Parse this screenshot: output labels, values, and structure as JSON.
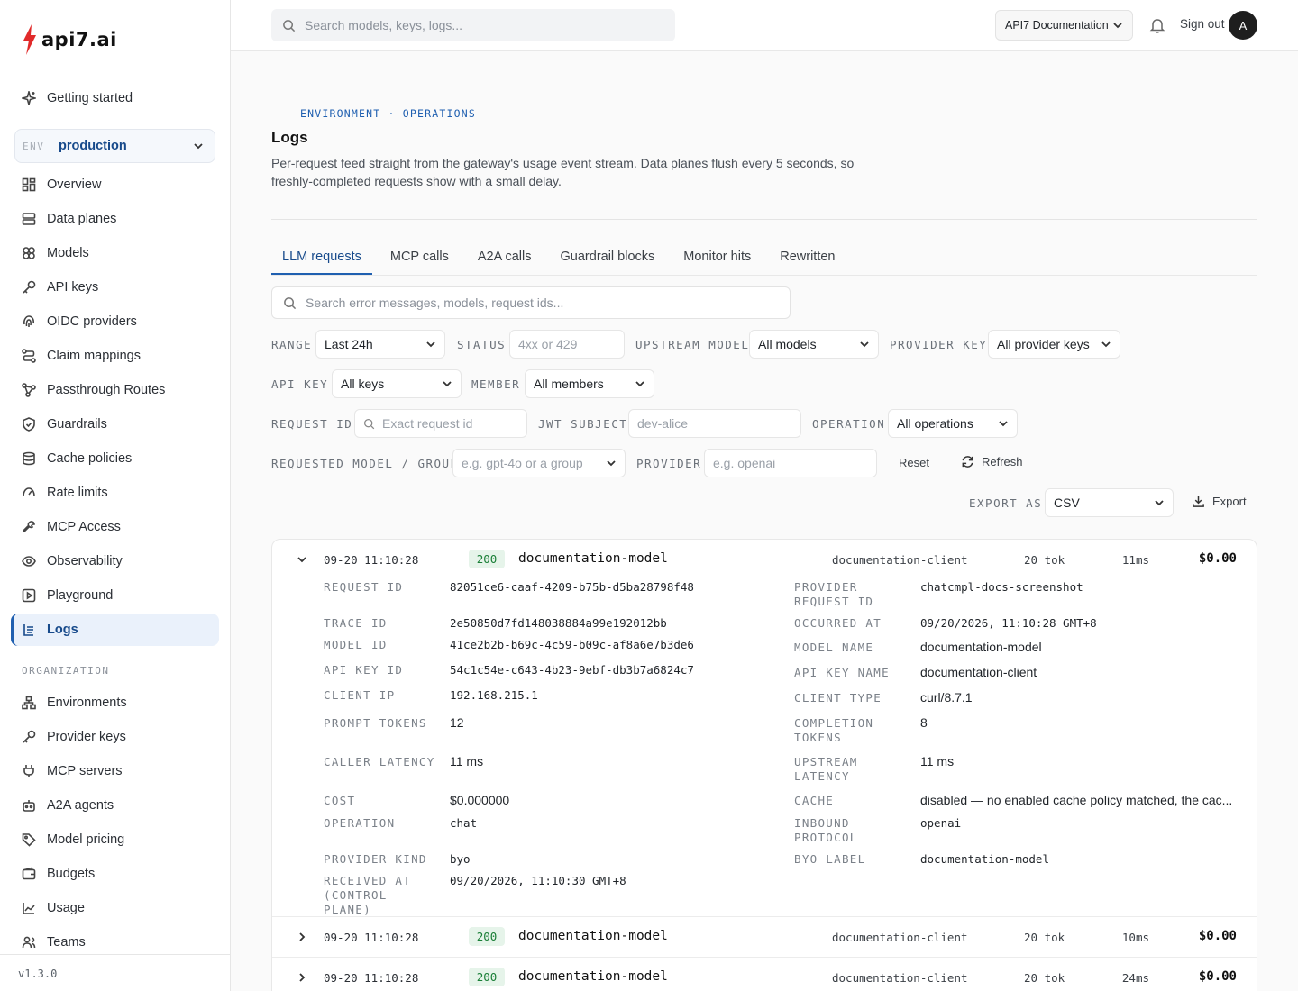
{
  "brand": {
    "name": "API7.AI",
    "text": "api7.ai"
  },
  "sidebar": {
    "getting_started": "Getting started",
    "env": {
      "tag": "ENV",
      "value": "production"
    },
    "items": [
      {
        "label": "Overview",
        "icon": "grid-icon"
      },
      {
        "label": "Data planes",
        "icon": "server-icon"
      },
      {
        "label": "Models",
        "icon": "cubes-icon"
      },
      {
        "label": "API keys",
        "icon": "key-icon"
      },
      {
        "label": "OIDC providers",
        "icon": "fingerprint-icon"
      },
      {
        "label": "Claim mappings",
        "icon": "route-icon"
      },
      {
        "label": "Passthrough Routes",
        "icon": "network-icon"
      },
      {
        "label": "Guardrails",
        "icon": "shield-icon"
      },
      {
        "label": "Cache policies",
        "icon": "database-icon"
      },
      {
        "label": "Rate limits",
        "icon": "gauge-icon"
      },
      {
        "label": "MCP Access",
        "icon": "wrench-icon"
      },
      {
        "label": "Observability",
        "icon": "eye-icon"
      },
      {
        "label": "Playground",
        "icon": "play-icon"
      },
      {
        "label": "Logs",
        "icon": "logs-icon"
      }
    ],
    "org_label": "ORGANIZATION",
    "org_items": [
      {
        "label": "Environments",
        "icon": "tree-icon"
      },
      {
        "label": "Provider keys",
        "icon": "key-icon"
      },
      {
        "label": "MCP servers",
        "icon": "plug-icon"
      },
      {
        "label": "A2A agents",
        "icon": "bot-icon"
      },
      {
        "label": "Model pricing",
        "icon": "tag-icon"
      },
      {
        "label": "Budgets",
        "icon": "wallet-icon"
      },
      {
        "label": "Usage",
        "icon": "chart-icon"
      },
      {
        "label": "Teams",
        "icon": "users-icon"
      }
    ],
    "version": "v1.3.0"
  },
  "topbar": {
    "search_placeholder": "Search models, keys, logs...",
    "doc_select": "API7 Documentation",
    "sign_out": "Sign out",
    "avatar": "A"
  },
  "page": {
    "eyebrow": "ENVIRONMENT · OPERATIONS",
    "title": "Logs",
    "description": "Per-request feed straight from the gateway's usage event stream. Data planes flush every 5 seconds, so freshly-completed requests show with a small delay."
  },
  "tabs": [
    "LLM requests",
    "MCP calls",
    "A2A calls",
    "Guardrail blocks",
    "Monitor hits",
    "Rewritten"
  ],
  "filters": {
    "search_placeholder": "Search error messages, models, request ids...",
    "range_label": "RANGE",
    "range_value": "Last 24h",
    "status_label": "STATUS",
    "status_placeholder": "4xx or 429",
    "upstream_label": "UPSTREAM MODEL",
    "upstream_value": "All models",
    "provider_key_label": "PROVIDER KEY",
    "provider_key_value": "All provider keys",
    "api_key_label": "API KEY",
    "api_key_value": "All keys",
    "member_label": "MEMBER",
    "member_value": "All members",
    "request_id_label": "REQUEST ID",
    "request_id_placeholder": "Exact request id",
    "jwt_label": "JWT SUBJECT",
    "jwt_placeholder": "dev-alice",
    "operation_label": "OPERATION",
    "operation_value": "All operations",
    "requested_label": "REQUESTED MODEL / GROUP",
    "requested_placeholder": "e.g. gpt-4o or a group",
    "provider_label": "PROVIDER",
    "provider_placeholder": "e.g. openai",
    "reset": "Reset",
    "refresh": "Refresh",
    "export_label": "EXPORT AS",
    "export_value": "CSV",
    "export_button": "Export"
  },
  "rows": [
    {
      "time": "09-20 11:10:28",
      "status": "200",
      "model": "documentation-model",
      "client": "documentation-client",
      "tokens": "20 tok",
      "latency": "11ms",
      "cost": "$0.00",
      "expanded": true
    },
    {
      "time": "09-20 11:10:28",
      "status": "200",
      "model": "documentation-model",
      "client": "documentation-client",
      "tokens": "20 tok",
      "latency": "10ms",
      "cost": "$0.00",
      "expanded": false
    },
    {
      "time": "09-20 11:10:28",
      "status": "200",
      "model": "documentation-model",
      "client": "documentation-client",
      "tokens": "20 tok",
      "latency": "24ms",
      "cost": "$0.00",
      "expanded": false
    }
  ],
  "details": {
    "left": [
      {
        "key": "REQUEST ID",
        "value": "82051ce6-caaf-4209-b75b-d5ba28798f48"
      },
      {
        "key": "TRACE ID",
        "value": "2e50850d7fd148038884a99e192012bb"
      },
      {
        "key": "MODEL ID",
        "value": "41ce2b2b-b69c-4c59-b09c-af8a6e7b3de6"
      },
      {
        "key": "API KEY ID",
        "value": "54c1c54e-c643-4b23-9ebf-db3b7a6824c7"
      },
      {
        "key": "CLIENT IP",
        "value": "192.168.215.1"
      },
      {
        "key": "PROMPT TOKENS",
        "value": "12"
      },
      {
        "key": "CALLER LATENCY",
        "value": "11 ms"
      },
      {
        "key": "COST",
        "value": "$0.000000"
      },
      {
        "key": "OPERATION",
        "value": "chat"
      },
      {
        "key": "PROVIDER KIND",
        "value": "byo"
      },
      {
        "key": "RECEIVED AT (CONTROL PLANE)",
        "value": "09/20/2026, 11:10:30 GMT+8"
      }
    ],
    "right": [
      {
        "key": "PROVIDER REQUEST ID",
        "value": "chatcmpl-docs-screenshot"
      },
      {
        "key": "OCCURRED AT",
        "value": "09/20/2026, 11:10:28 GMT+8"
      },
      {
        "key": "MODEL NAME",
        "value": "documentation-model"
      },
      {
        "key": "API KEY NAME",
        "value": "documentation-client"
      },
      {
        "key": "CLIENT TYPE",
        "value": "curl/8.7.1"
      },
      {
        "key": "COMPLETION TOKENS",
        "value": "8"
      },
      {
        "key": "UPSTREAM LATENCY",
        "value": "11 ms"
      },
      {
        "key": "CACHE",
        "value": "disabled — no enabled cache policy matched, the cac..."
      },
      {
        "key": "INBOUND PROTOCOL",
        "value": "openai"
      },
      {
        "key": "BYO LABEL",
        "value": "documentation-model"
      }
    ]
  }
}
